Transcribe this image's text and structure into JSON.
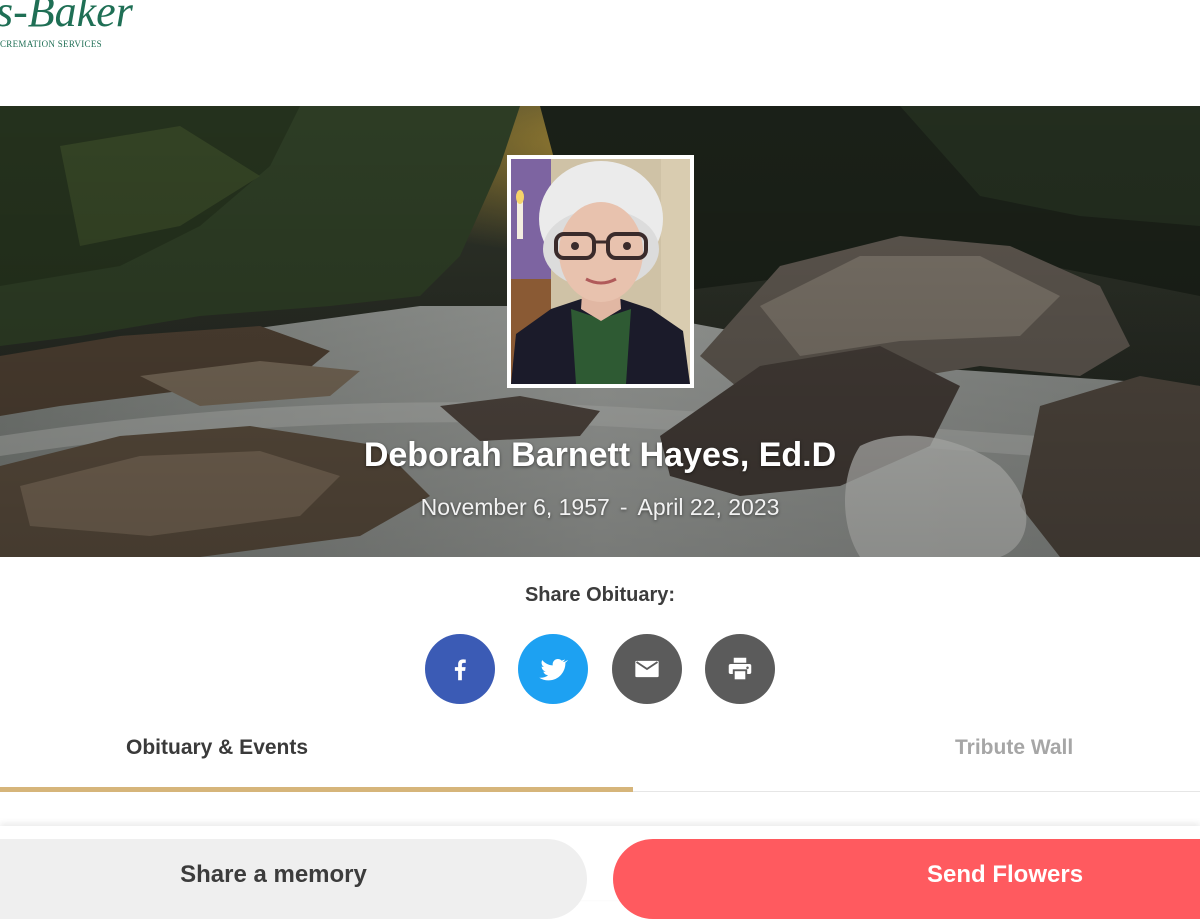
{
  "logo": {
    "main": "s-Baker",
    "sub": "CREMATION SERVICES"
  },
  "hero": {
    "name": "Deborah Barnett Hayes, Ed.D",
    "birth_date": "November 6, 1957",
    "date_separator": "-",
    "death_date": "April 22, 2023"
  },
  "share": {
    "label": "Share Obituary:",
    "buttons": [
      {
        "icon": "facebook-icon",
        "color": "#3b5bb5"
      },
      {
        "icon": "twitter-icon",
        "color": "#1da1f2"
      },
      {
        "icon": "email-icon",
        "color": "#5b5b5b"
      },
      {
        "icon": "print-icon",
        "color": "#5b5b5b"
      }
    ]
  },
  "tabs": [
    {
      "label": "Obituary & Events",
      "active": true
    },
    {
      "label": "Tribute Wall",
      "active": false
    }
  ],
  "actions": {
    "share_memory": "Share a memory",
    "send_flowers": "Send Flowers"
  },
  "colors": {
    "brand_green": "#1f6f55",
    "accent_gold": "#d6b57a",
    "flowers_red": "#ff5a5f"
  }
}
